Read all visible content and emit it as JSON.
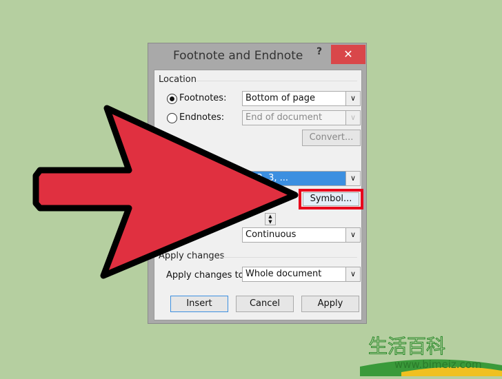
{
  "dialog": {
    "title": "Footnote and Endnote",
    "help": "?",
    "close": "✕"
  },
  "location": {
    "label": "Location",
    "footnotes": {
      "label": "Footnotes:",
      "value": "Bottom of page",
      "selected": true
    },
    "endnotes": {
      "label": "Endnotes:",
      "value": "End of document",
      "selected": false
    },
    "convert": "Convert..."
  },
  "format": {
    "number_format_value": "1, 2, 3, ...",
    "symbol_button": "Symbol...",
    "numbering_value": "Continuous"
  },
  "apply": {
    "label": "Apply changes",
    "apply_to_label": "Apply changes to:",
    "apply_to_value": "Whole document"
  },
  "buttons": {
    "insert": "Insert",
    "cancel": "Cancel",
    "apply": "Apply"
  },
  "highlight_color": "#e8001c",
  "arrow_color": "#e03040",
  "watermark": {
    "text": "生活百科",
    "url": "www.bimeiz.com"
  }
}
